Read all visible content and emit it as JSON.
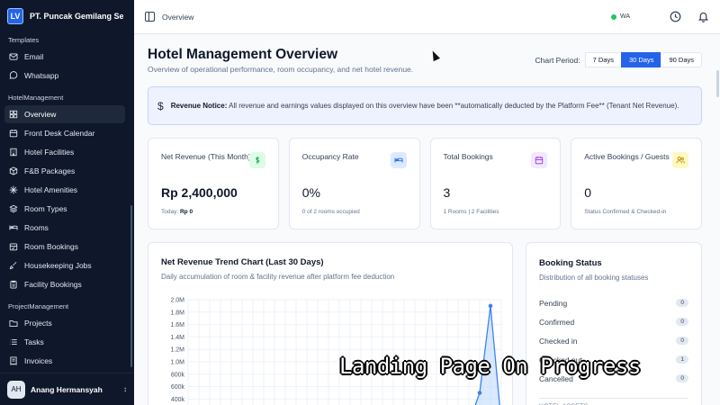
{
  "brand": {
    "logo_text": "LV",
    "name": "PT. Puncak Gemilang Sej..."
  },
  "sidebar": {
    "sections": [
      {
        "label": "Templates",
        "items": [
          {
            "label": "Email",
            "icon": "mail-icon"
          },
          {
            "label": "Whatsapp",
            "icon": "message-icon"
          }
        ]
      },
      {
        "label": "HotelManagement",
        "items": [
          {
            "label": "Overview",
            "icon": "grid-icon",
            "active": true
          },
          {
            "label": "Front Desk Calendar",
            "icon": "calendar-icon"
          },
          {
            "label": "Hotel Facilities",
            "icon": "building-icon"
          },
          {
            "label": "F&B Packages",
            "icon": "package-icon"
          },
          {
            "label": "Hotel Amenities",
            "icon": "sparkle-icon"
          },
          {
            "label": "Room Types",
            "icon": "layers-icon"
          },
          {
            "label": "Rooms",
            "icon": "bed-icon"
          },
          {
            "label": "Room Bookings",
            "icon": "booking-icon"
          },
          {
            "label": "Housekeeping Jobs",
            "icon": "broom-icon"
          },
          {
            "label": "Facility Bookings",
            "icon": "clipboard-icon"
          }
        ]
      },
      {
        "label": "ProjectManagement",
        "items": [
          {
            "label": "Projects",
            "icon": "folder-icon"
          },
          {
            "label": "Tasks",
            "icon": "list-icon"
          },
          {
            "label": "Invoices",
            "icon": "invoice-icon"
          }
        ]
      }
    ]
  },
  "user": {
    "initials": "AH",
    "name": "Anang Hermansyah"
  },
  "topbar": {
    "breadcrumb": "Overview",
    "wa_label": "WA"
  },
  "page": {
    "title": "Hotel Management Overview",
    "subtitle": "Overview of operational performance, room occupancy, and net hotel revenue.",
    "period_label": "Chart Period:",
    "periods": [
      "7 Days",
      "30 Days",
      "90 Days"
    ],
    "active_period": "30 Days"
  },
  "notice": {
    "strong": "Revenue Notice:",
    "text": " All revenue and earnings values displayed on this overview have been **automatically deducted by the Platform Fee** (Tenant Net Revenue)."
  },
  "cards": [
    {
      "label": "Net Revenue (This Month)",
      "value": "Rp 2,400,000",
      "foot_prefix": "Today: ",
      "foot_strong": "Rp 0",
      "icon": "dollar-icon",
      "icon_bg": "#dcfce7",
      "icon_color": "#16a34a"
    },
    {
      "label": "Occupancy Rate",
      "value": "0%",
      "foot_prefix": "0 of 2 rooms occupied",
      "foot_strong": "",
      "icon": "bed-icon",
      "icon_bg": "#dbeafe",
      "icon_color": "#2563eb"
    },
    {
      "label": "Total Bookings",
      "value": "3",
      "foot_prefix": "1 Rooms | 2 Facilities",
      "foot_strong": "",
      "icon": "calendar-icon",
      "icon_bg": "#f3e8ff",
      "icon_color": "#9333ea"
    },
    {
      "label": "Active Bookings / Guests",
      "value": "0",
      "foot_prefix": "Status Confirmed & Checked-in",
      "foot_strong": "",
      "icon": "users-icon",
      "icon_bg": "#fef9c3",
      "icon_color": "#ca8a04"
    }
  ],
  "chart": {
    "title": "Net Revenue Trend Chart (Last 30 Days)",
    "subtitle": "Daily accumulation of room & facility revenue after platform fee deduction"
  },
  "chart_data": {
    "type": "area",
    "title": "Net Revenue Trend Chart (Last 30 Days)",
    "yticks": [
      "2.0M",
      "1.8M",
      "1.6M",
      "1.4M",
      "1.2M",
      "1.0M",
      "800k",
      "600k",
      "400k"
    ],
    "ylim": [
      400000,
      2000000
    ],
    "grid": true,
    "series": [
      {
        "values": [
          0,
          0,
          0,
          0,
          0,
          0,
          0,
          0,
          0,
          0,
          0,
          0,
          0,
          0,
          0,
          0,
          0,
          0,
          0,
          0,
          0,
          0,
          0,
          0,
          0,
          0,
          0,
          500000,
          1900000,
          0
        ]
      }
    ],
    "colors": {
      "line": "#3b82f6",
      "fill": "#bfdbfe"
    }
  },
  "booking_status": {
    "title": "Booking Status",
    "subtitle": "Distribution of all booking statuses",
    "rows": [
      {
        "label": "Pending",
        "count": "0"
      },
      {
        "label": "Confirmed",
        "count": "0"
      },
      {
        "label": "Checked in",
        "count": "0"
      },
      {
        "label": "Checked out",
        "count": "1"
      },
      {
        "label": "Cancelled",
        "count": "0"
      }
    ],
    "assets_label": "HOTEL ASSETS"
  },
  "overlay_text": "Landing Page On Progress"
}
